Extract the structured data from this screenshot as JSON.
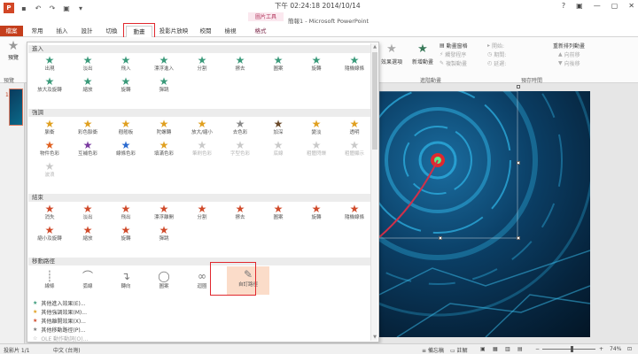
{
  "titlebar": {
    "clock": "下午 02:24:18 2014/10/14",
    "doc_title": "簡報1 - Microsoft PowerPoint",
    "context_group": "圖片工具",
    "qat_icons": [
      "powerpoint-logo",
      "save-icon",
      "undo-icon",
      "redo-icon",
      "start-from-beginning-icon",
      "customize-icon"
    ],
    "window_controls": [
      "?",
      "▣",
      "—",
      "▢",
      "✕"
    ]
  },
  "tabs": {
    "file": "檔案",
    "items": [
      "常用",
      "插入",
      "設計",
      "切換",
      "動畫",
      "投影片放映",
      "校閱",
      "檢視",
      "格式"
    ],
    "active_index": 4,
    "sign_in": "登入"
  },
  "ribbon": {
    "preview_label": "預覽",
    "preview_group": "預覽",
    "effect_options": "效果選項",
    "add_animation": "新增動畫",
    "animation_pane": "動畫窗格",
    "trigger": "觸發程序",
    "animation_painter": "複製動畫",
    "advanced_group": "進階動畫",
    "start": "開始:",
    "duration": "期間:",
    "delay": "延遲:",
    "reorder": "重新排列動畫",
    "move_earlier": "向前移",
    "move_later": "向後移",
    "timing_group": "預存時間"
  },
  "gallery": {
    "sections": {
      "entrance": "進入",
      "emphasis": "強調",
      "exit": "結束",
      "motion": "移動路徑"
    },
    "entrance": [
      {
        "label": "出現",
        "color": "#3a9a7a"
      },
      {
        "label": "淡出",
        "color": "#3a9a7a"
      },
      {
        "label": "飛入",
        "color": "#3a9a7a"
      },
      {
        "label": "漂浮進入",
        "color": "#3a9a7a"
      },
      {
        "label": "分割",
        "color": "#3a9a7a"
      },
      {
        "label": "擦去",
        "color": "#3a9a7a"
      },
      {
        "label": "圖案",
        "color": "#3a9a7a"
      },
      {
        "label": "旋轉",
        "color": "#3a9a7a"
      },
      {
        "label": "隨機線條",
        "color": "#3a9a7a"
      },
      {
        "label": "放大及旋轉",
        "color": "#3a9a7a"
      },
      {
        "label": "縮放",
        "color": "#3a9a7a"
      },
      {
        "label": "旋轉",
        "color": "#3a9a7a"
      },
      {
        "label": "彈跳",
        "color": "#3a9a7a"
      }
    ],
    "emphasis": [
      {
        "label": "脈衝",
        "color": "#e0a020",
        "disabled": false
      },
      {
        "label": "彩色脈衝",
        "color": "#e0a020",
        "disabled": false
      },
      {
        "label": "翹翹板",
        "color": "#e0a020",
        "disabled": false
      },
      {
        "label": "陀螺轉",
        "color": "#e0a020",
        "disabled": false
      },
      {
        "label": "放大/縮小",
        "color": "#e0a020",
        "disabled": false
      },
      {
        "label": "去色彩",
        "color": "#8a8a8a",
        "disabled": false
      },
      {
        "label": "加深",
        "color": "#6a4a2a",
        "disabled": false
      },
      {
        "label": "變淡",
        "color": "#e0a020",
        "disabled": false
      },
      {
        "label": "透明",
        "color": "#e0a020",
        "disabled": false
      },
      {
        "label": "物件色彩",
        "color": "#e06020",
        "disabled": false
      },
      {
        "label": "互補色彩",
        "color": "#7a3aa0",
        "disabled": false
      },
      {
        "label": "線條色彩",
        "color": "#2a6ad0",
        "disabled": false
      },
      {
        "label": "填滿色彩",
        "color": "#e0a020",
        "disabled": false
      },
      {
        "label": "筆刷色彩",
        "color": "#c9c9c9",
        "disabled": true
      },
      {
        "label": "字型色彩",
        "color": "#c9c9c9",
        "disabled": true
      },
      {
        "label": "底線",
        "color": "#c9c9c9",
        "disabled": true
      },
      {
        "label": "粗體閃爍",
        "color": "#c9c9c9",
        "disabled": true
      },
      {
        "label": "粗體顯示",
        "color": "#c9c9c9",
        "disabled": true
      },
      {
        "label": "波浪",
        "color": "#c9c9c9",
        "disabled": true
      }
    ],
    "exit": [
      {
        "label": "消失",
        "color": "#d04a2a"
      },
      {
        "label": "淡出",
        "color": "#d04a2a"
      },
      {
        "label": "飛出",
        "color": "#d04a2a"
      },
      {
        "label": "漂浮離開",
        "color": "#d04a2a"
      },
      {
        "label": "分割",
        "color": "#d04a2a"
      },
      {
        "label": "擦去",
        "color": "#d04a2a"
      },
      {
        "label": "圖案",
        "color": "#d04a2a"
      },
      {
        "label": "旋轉",
        "color": "#d04a2a"
      },
      {
        "label": "隨機線條",
        "color": "#d04a2a"
      },
      {
        "label": "縮小及旋轉",
        "color": "#d04a2a"
      },
      {
        "label": "縮放",
        "color": "#d04a2a"
      },
      {
        "label": "旋轉",
        "color": "#d04a2a"
      },
      {
        "label": "彈跳",
        "color": "#d04a2a"
      }
    ],
    "motion": [
      {
        "label": "線條",
        "icon": "line-path-icon"
      },
      {
        "label": "弧線",
        "icon": "arc-path-icon"
      },
      {
        "label": "轉向",
        "icon": "turn-path-icon"
      },
      {
        "label": "圖案",
        "icon": "shape-path-icon"
      },
      {
        "label": "迴圈",
        "icon": "loop-path-icon"
      },
      {
        "label": "自訂路徑",
        "icon": "custom-path-icon"
      }
    ],
    "more": [
      {
        "label": "其他進入效果(E)...",
        "color": "#3a9a7a",
        "disabled": false
      },
      {
        "label": "其他強調效果(M)...",
        "color": "#e0a020",
        "disabled": false
      },
      {
        "label": "其他離開效果(X)...",
        "color": "#d04a2a",
        "disabled": false
      },
      {
        "label": "其他移動路徑(P)...",
        "color": "#777777",
        "disabled": false
      },
      {
        "label": "OLE 動作動詞(O)...",
        "color": "#aaaaaa",
        "disabled": true
      }
    ]
  },
  "slides": {
    "number": "1"
  },
  "statusbar": {
    "slide_info": "投影片 1/1",
    "language": "中文 (台灣)",
    "notes": "備忘稿",
    "comments": "註解",
    "zoom": "74%",
    "zoom_level": 0.55
  }
}
